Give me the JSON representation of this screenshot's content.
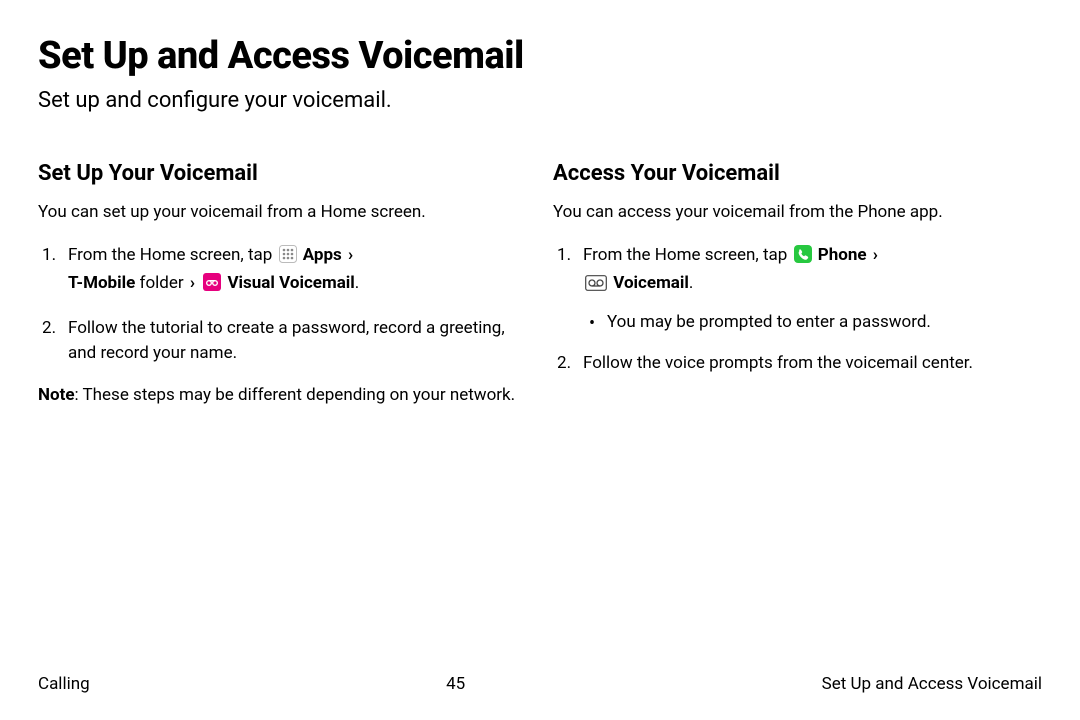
{
  "header": {
    "title": "Set Up and Access Voicemail",
    "subtitle": "Set up and configure your voicemail."
  },
  "left": {
    "heading": "Set Up Your Voicemail",
    "intro": "You can set up your voicemail from a Home screen.",
    "step1_pre": "From the Home screen, tap ",
    "step1_apps": "Apps",
    "step1_tmobile": "T-Mobile",
    "step1_folder": " folder ",
    "step1_visual": " Visual Voicemail",
    "step2": "Follow the tutorial to create a password, record a greeting, and record your name.",
    "note_label": "Note",
    "note_body": ": These steps may be different depending on your network."
  },
  "right": {
    "heading": "Access Your Voicemail",
    "intro": "You can access your voicemail from the Phone app.",
    "step1_pre": "From the Home screen, tap ",
    "step1_phone": "Phone",
    "step1_voicemail": " Voicemail",
    "bullet1": "You may be prompted to enter a password.",
    "step2": "Follow the voice prompts from the voicemail center."
  },
  "footer": {
    "left": "Calling",
    "center": "45",
    "right": "Set Up and Access Voicemail"
  },
  "icons": {
    "apps": "apps-grid-icon",
    "visual_voicemail": "visual-voicemail-icon",
    "phone": "phone-icon",
    "voicemail": "voicemail-icon"
  }
}
